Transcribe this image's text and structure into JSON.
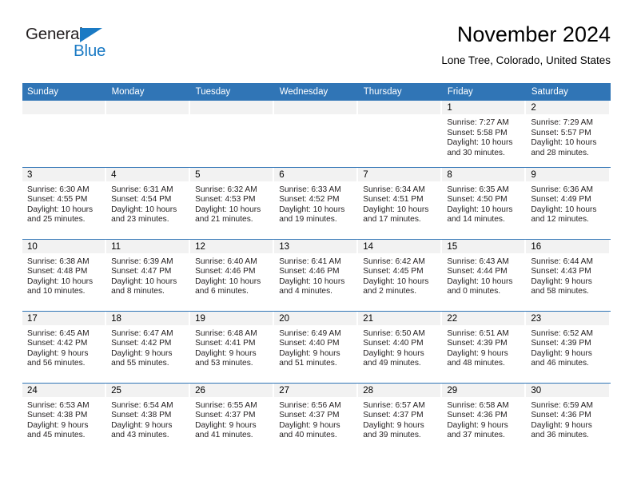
{
  "brand": {
    "name_part1": "General",
    "name_part2": "Blue",
    "accent_color": "#1a7ac4"
  },
  "header": {
    "title": "November 2024",
    "subtitle": "Lone Tree, Colorado, United States"
  },
  "theme": {
    "header_blue": "#3075b6",
    "daynum_strip": "#f2f2f2",
    "text": "#231f20"
  },
  "calendar": {
    "weekday_headers": [
      "Sunday",
      "Monday",
      "Tuesday",
      "Wednesday",
      "Thursday",
      "Friday",
      "Saturday"
    ],
    "weeks": [
      [
        {
          "day": "",
          "empty": true
        },
        {
          "day": "",
          "empty": true
        },
        {
          "day": "",
          "empty": true
        },
        {
          "day": "",
          "empty": true
        },
        {
          "day": "",
          "empty": true
        },
        {
          "day": "1",
          "sunrise": "Sunrise: 7:27 AM",
          "sunset": "Sunset: 5:58 PM",
          "daylight": "Daylight: 10 hours and 30 minutes."
        },
        {
          "day": "2",
          "sunrise": "Sunrise: 7:29 AM",
          "sunset": "Sunset: 5:57 PM",
          "daylight": "Daylight: 10 hours and 28 minutes."
        }
      ],
      [
        {
          "day": "3",
          "sunrise": "Sunrise: 6:30 AM",
          "sunset": "Sunset: 4:55 PM",
          "daylight": "Daylight: 10 hours and 25 minutes."
        },
        {
          "day": "4",
          "sunrise": "Sunrise: 6:31 AM",
          "sunset": "Sunset: 4:54 PM",
          "daylight": "Daylight: 10 hours and 23 minutes."
        },
        {
          "day": "5",
          "sunrise": "Sunrise: 6:32 AM",
          "sunset": "Sunset: 4:53 PM",
          "daylight": "Daylight: 10 hours and 21 minutes."
        },
        {
          "day": "6",
          "sunrise": "Sunrise: 6:33 AM",
          "sunset": "Sunset: 4:52 PM",
          "daylight": "Daylight: 10 hours and 19 minutes."
        },
        {
          "day": "7",
          "sunrise": "Sunrise: 6:34 AM",
          "sunset": "Sunset: 4:51 PM",
          "daylight": "Daylight: 10 hours and 17 minutes."
        },
        {
          "day": "8",
          "sunrise": "Sunrise: 6:35 AM",
          "sunset": "Sunset: 4:50 PM",
          "daylight": "Daylight: 10 hours and 14 minutes."
        },
        {
          "day": "9",
          "sunrise": "Sunrise: 6:36 AM",
          "sunset": "Sunset: 4:49 PM",
          "daylight": "Daylight: 10 hours and 12 minutes."
        }
      ],
      [
        {
          "day": "10",
          "sunrise": "Sunrise: 6:38 AM",
          "sunset": "Sunset: 4:48 PM",
          "daylight": "Daylight: 10 hours and 10 minutes."
        },
        {
          "day": "11",
          "sunrise": "Sunrise: 6:39 AM",
          "sunset": "Sunset: 4:47 PM",
          "daylight": "Daylight: 10 hours and 8 minutes."
        },
        {
          "day": "12",
          "sunrise": "Sunrise: 6:40 AM",
          "sunset": "Sunset: 4:46 PM",
          "daylight": "Daylight: 10 hours and 6 minutes."
        },
        {
          "day": "13",
          "sunrise": "Sunrise: 6:41 AM",
          "sunset": "Sunset: 4:46 PM",
          "daylight": "Daylight: 10 hours and 4 minutes."
        },
        {
          "day": "14",
          "sunrise": "Sunrise: 6:42 AM",
          "sunset": "Sunset: 4:45 PM",
          "daylight": "Daylight: 10 hours and 2 minutes."
        },
        {
          "day": "15",
          "sunrise": "Sunrise: 6:43 AM",
          "sunset": "Sunset: 4:44 PM",
          "daylight": "Daylight: 10 hours and 0 minutes."
        },
        {
          "day": "16",
          "sunrise": "Sunrise: 6:44 AM",
          "sunset": "Sunset: 4:43 PM",
          "daylight": "Daylight: 9 hours and 58 minutes."
        }
      ],
      [
        {
          "day": "17",
          "sunrise": "Sunrise: 6:45 AM",
          "sunset": "Sunset: 4:42 PM",
          "daylight": "Daylight: 9 hours and 56 minutes."
        },
        {
          "day": "18",
          "sunrise": "Sunrise: 6:47 AM",
          "sunset": "Sunset: 4:42 PM",
          "daylight": "Daylight: 9 hours and 55 minutes."
        },
        {
          "day": "19",
          "sunrise": "Sunrise: 6:48 AM",
          "sunset": "Sunset: 4:41 PM",
          "daylight": "Daylight: 9 hours and 53 minutes."
        },
        {
          "day": "20",
          "sunrise": "Sunrise: 6:49 AM",
          "sunset": "Sunset: 4:40 PM",
          "daylight": "Daylight: 9 hours and 51 minutes."
        },
        {
          "day": "21",
          "sunrise": "Sunrise: 6:50 AM",
          "sunset": "Sunset: 4:40 PM",
          "daylight": "Daylight: 9 hours and 49 minutes."
        },
        {
          "day": "22",
          "sunrise": "Sunrise: 6:51 AM",
          "sunset": "Sunset: 4:39 PM",
          "daylight": "Daylight: 9 hours and 48 minutes."
        },
        {
          "day": "23",
          "sunrise": "Sunrise: 6:52 AM",
          "sunset": "Sunset: 4:39 PM",
          "daylight": "Daylight: 9 hours and 46 minutes."
        }
      ],
      [
        {
          "day": "24",
          "sunrise": "Sunrise: 6:53 AM",
          "sunset": "Sunset: 4:38 PM",
          "daylight": "Daylight: 9 hours and 45 minutes."
        },
        {
          "day": "25",
          "sunrise": "Sunrise: 6:54 AM",
          "sunset": "Sunset: 4:38 PM",
          "daylight": "Daylight: 9 hours and 43 minutes."
        },
        {
          "day": "26",
          "sunrise": "Sunrise: 6:55 AM",
          "sunset": "Sunset: 4:37 PM",
          "daylight": "Daylight: 9 hours and 41 minutes."
        },
        {
          "day": "27",
          "sunrise": "Sunrise: 6:56 AM",
          "sunset": "Sunset: 4:37 PM",
          "daylight": "Daylight: 9 hours and 40 minutes."
        },
        {
          "day": "28",
          "sunrise": "Sunrise: 6:57 AM",
          "sunset": "Sunset: 4:37 PM",
          "daylight": "Daylight: 9 hours and 39 minutes."
        },
        {
          "day": "29",
          "sunrise": "Sunrise: 6:58 AM",
          "sunset": "Sunset: 4:36 PM",
          "daylight": "Daylight: 9 hours and 37 minutes."
        },
        {
          "day": "30",
          "sunrise": "Sunrise: 6:59 AM",
          "sunset": "Sunset: 4:36 PM",
          "daylight": "Daylight: 9 hours and 36 minutes."
        }
      ]
    ]
  }
}
